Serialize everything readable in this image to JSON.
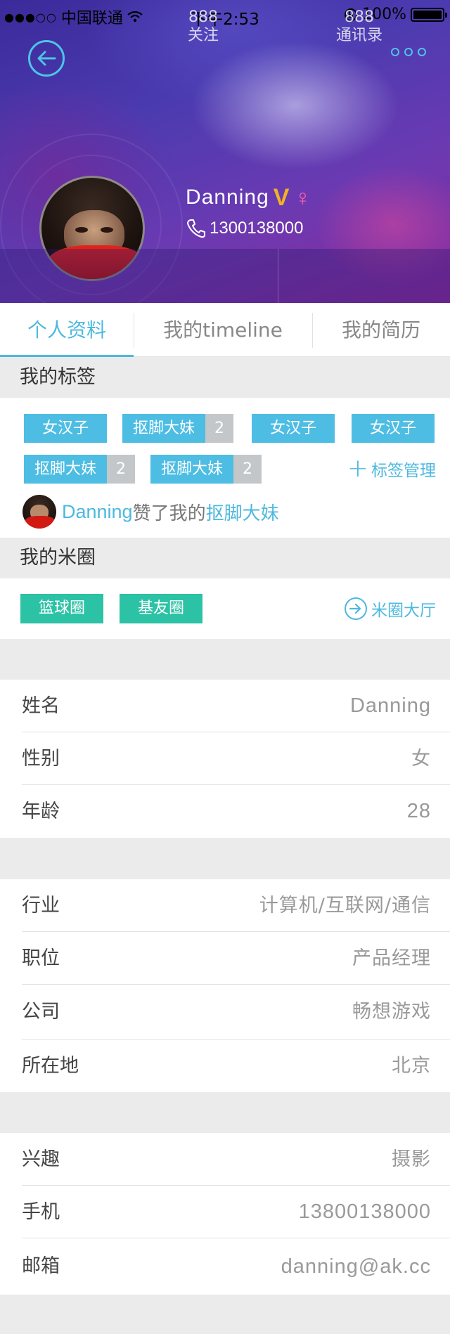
{
  "status_bar": {
    "carrier": "中国联通",
    "time": "下午2:53",
    "battery": "100%"
  },
  "profile": {
    "name": "Danning",
    "vip_badge": "V",
    "gender_symbol": "♀",
    "phone": "1300138000",
    "stats": [
      {
        "count": "888",
        "label": "关注"
      },
      {
        "count": "888",
        "label": "通讯录"
      }
    ]
  },
  "tabs": [
    {
      "label": "个人资料",
      "active": true
    },
    {
      "label": "我的timeline",
      "active": false
    },
    {
      "label": "我的简历",
      "active": false
    }
  ],
  "tags_section": {
    "title": "我的标签",
    "tags": [
      {
        "label": "女汉子",
        "count": null
      },
      {
        "label": "抠脚大妹",
        "count": "2"
      },
      {
        "label": "女汉子",
        "count": null
      },
      {
        "label": "女汉子",
        "count": null
      },
      {
        "label": "抠脚大妹",
        "count": "2"
      },
      {
        "label": "抠脚大妹",
        "count": "2"
      }
    ],
    "manage_label": "标签管理",
    "like_activity": {
      "user": "Danning",
      "text": "赞了我的",
      "tag": "抠脚大妹"
    }
  },
  "circles_section": {
    "title": "我的米圈",
    "circles": [
      "篮球圈",
      "基友圈"
    ],
    "hall_label": "米圈大厅"
  },
  "basic_info": [
    {
      "key": "姓名",
      "value": "Danning"
    },
    {
      "key": "性别",
      "value": "女"
    },
    {
      "key": "年龄",
      "value": "28"
    }
  ],
  "work_info": [
    {
      "key": "行业",
      "value": "计算机/互联网/通信"
    },
    {
      "key": "职位",
      "value": "产品经理"
    },
    {
      "key": "公司",
      "value": "畅想游戏"
    },
    {
      "key": "所在地",
      "value": "北京"
    }
  ],
  "contact_info": [
    {
      "key": "兴趣",
      "value": "摄影"
    },
    {
      "key": "手机",
      "value": "13800138000"
    },
    {
      "key": "邮箱",
      "value": "danning@ak.cc"
    }
  ],
  "colors": {
    "accent": "#4cb9de",
    "tag_blue": "#4dbde3",
    "circle_green": "#2cc2a5",
    "vip_gold": "#f0b323",
    "female_pink": "#ff5fa8"
  }
}
